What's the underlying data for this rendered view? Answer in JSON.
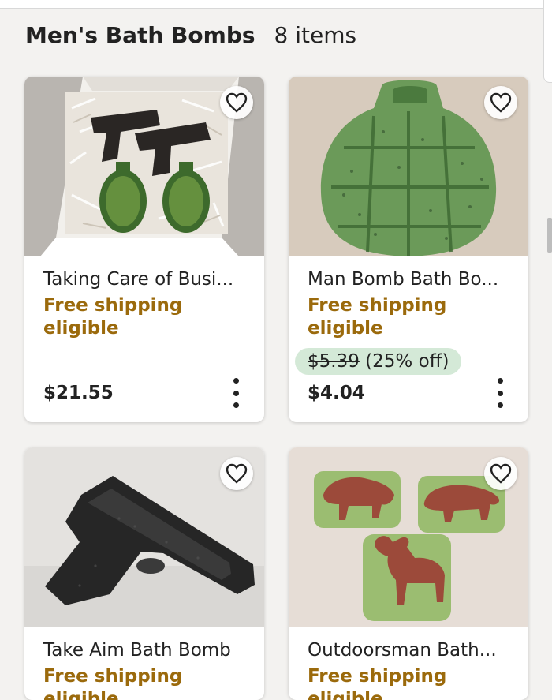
{
  "section": {
    "title": "Men's Bath Bombs",
    "count": "8 items"
  },
  "products": [
    {
      "title": "Taking Care of Busi...",
      "shipping": "Free shipping eligible",
      "price": "$21.55",
      "image_icon": "gift-box-image"
    },
    {
      "title": "Man Bomb Bath Bo...",
      "shipping": "Free shipping eligible",
      "original_price": "$5.39",
      "discount": "(25% off)",
      "price": "$4.04",
      "image_icon": "grenade-bath-bomb-image"
    },
    {
      "title": "Take Aim Bath Bomb",
      "shipping": "Free shipping eligible",
      "image_icon": "gun-bath-bomb-image"
    },
    {
      "title": "Outdoorsman Bath...",
      "shipping": "Free shipping eligible",
      "image_icon": "animal-bath-bombs-image"
    }
  ],
  "colors": {
    "shipping_text": "#9b6a0c",
    "discount_badge": "#d4e9d7",
    "background": "#f3f2f0"
  }
}
